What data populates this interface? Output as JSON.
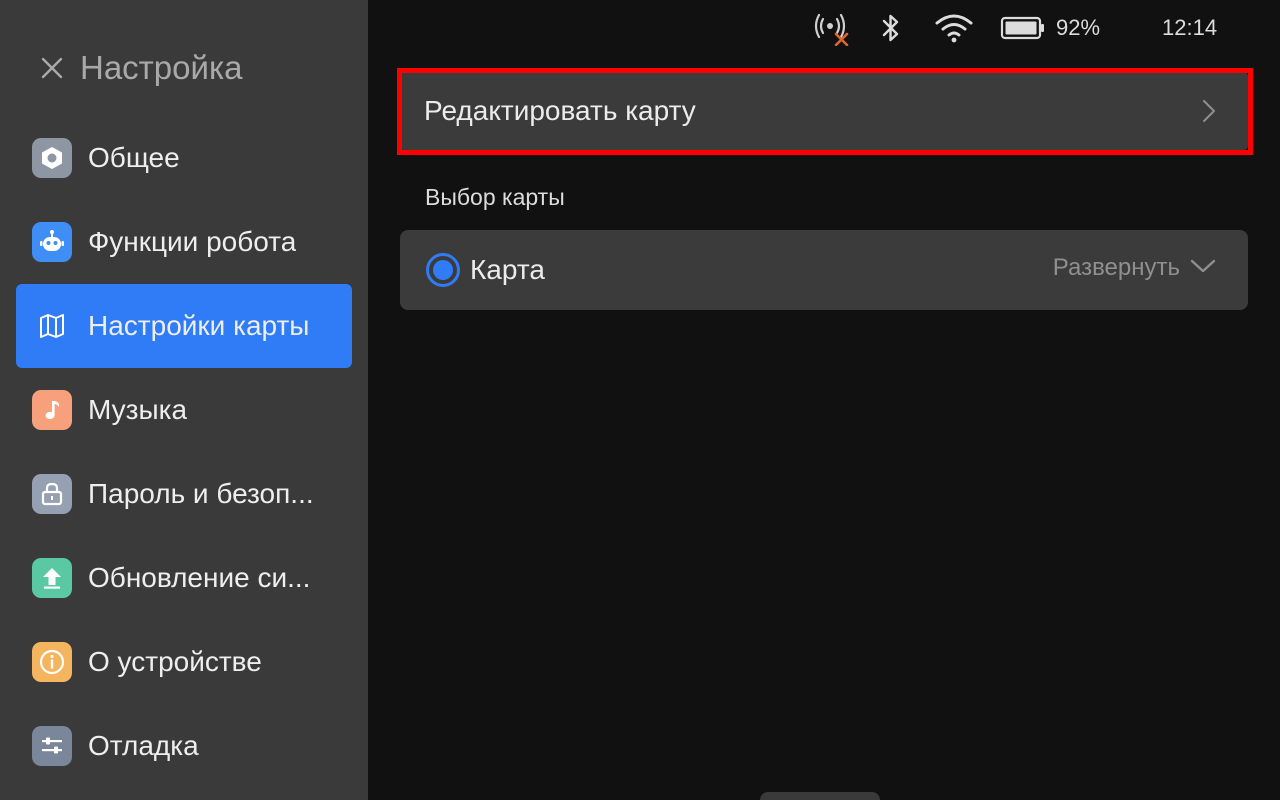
{
  "sidebar": {
    "title": "Настройка",
    "items": [
      {
        "label": "Общее",
        "icon": "hexagon-icon",
        "color": "#8e96a3"
      },
      {
        "label": "Функции робота",
        "icon": "robot-icon",
        "color": "#3f8ef5"
      },
      {
        "label": "Настройки карты",
        "icon": "map-icon",
        "color": "#2f7cf6",
        "active": true
      },
      {
        "label": "Музыка",
        "icon": "music-note-icon",
        "color": "#f7a07c"
      },
      {
        "label": "Пароль и безоп...",
        "icon": "lock-icon",
        "color": "#96a0b3"
      },
      {
        "label": "Обновление си...",
        "icon": "upload-arrow-icon",
        "color": "#5bc8a4"
      },
      {
        "label": "О устройстве",
        "icon": "info-icon",
        "color": "#f5b45e"
      },
      {
        "label": "Отладка",
        "icon": "sliders-icon",
        "color": "#7a8699"
      }
    ]
  },
  "status": {
    "battery": "92%",
    "time": "12:14"
  },
  "main": {
    "edit_map_label": "Редактировать карту",
    "section_title": "Выбор карты",
    "map_item": {
      "name": "Карта",
      "expand_label": "Развернуть",
      "selected": true
    }
  },
  "colors": {
    "accent": "#2f7cf6",
    "highlight": "#ff0000",
    "sidebar_bg": "#3a3a3a",
    "card_bg": "#3b3b3b",
    "bg": "#111111"
  }
}
